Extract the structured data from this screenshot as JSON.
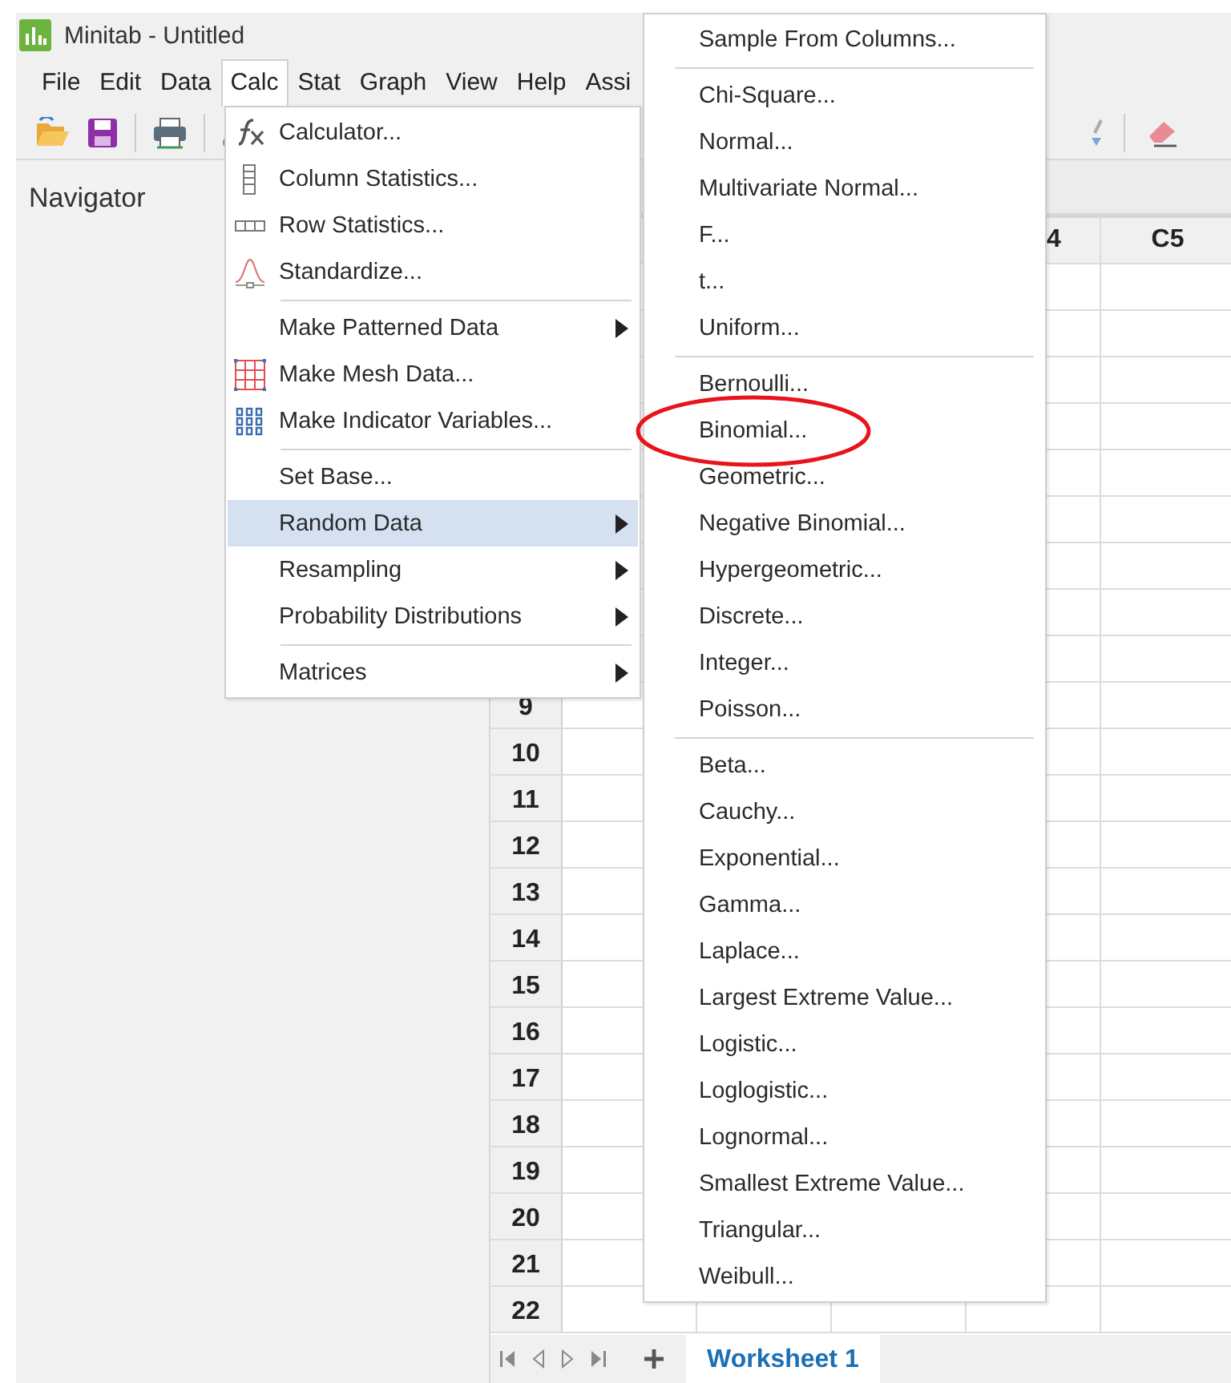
{
  "window": {
    "title": "Minitab - Untitled"
  },
  "menu_bar": [
    {
      "label": "File",
      "selected": false
    },
    {
      "label": "Edit",
      "selected": false
    },
    {
      "label": "Data",
      "selected": false
    },
    {
      "label": "Calc",
      "selected": true
    },
    {
      "label": "Stat",
      "selected": false
    },
    {
      "label": "Graph",
      "selected": false
    },
    {
      "label": "View",
      "selected": false
    },
    {
      "label": "Help",
      "selected": false
    },
    {
      "label": "Assi",
      "selected": false
    }
  ],
  "navigator": {
    "title": "Navigator"
  },
  "calc_menu": {
    "items": [
      {
        "kind": "item",
        "label": "Calculator...",
        "submenu": false,
        "selected": false
      },
      {
        "kind": "item",
        "label": "Column Statistics...",
        "submenu": false,
        "selected": false
      },
      {
        "kind": "item",
        "label": "Row Statistics...",
        "submenu": false,
        "selected": false
      },
      {
        "kind": "item",
        "label": "Standardize...",
        "submenu": false,
        "selected": false
      },
      {
        "kind": "separator"
      },
      {
        "kind": "item",
        "label": "Make Patterned Data",
        "submenu": true,
        "selected": false
      },
      {
        "kind": "item",
        "label": "Make Mesh Data...",
        "submenu": false,
        "selected": false
      },
      {
        "kind": "item",
        "label": "Make Indicator Variables...",
        "submenu": false,
        "selected": false
      },
      {
        "kind": "separator"
      },
      {
        "kind": "item",
        "label": "Set Base...",
        "submenu": false,
        "selected": false
      },
      {
        "kind": "item",
        "label": "Random Data",
        "submenu": true,
        "selected": true
      },
      {
        "kind": "item",
        "label": "Resampling",
        "submenu": true,
        "selected": false
      },
      {
        "kind": "item",
        "label": "Probability Distributions",
        "submenu": true,
        "selected": false
      },
      {
        "kind": "separator"
      },
      {
        "kind": "item",
        "label": "Matrices",
        "submenu": true,
        "selected": false
      }
    ]
  },
  "random_data_menu": {
    "items": [
      {
        "kind": "item",
        "label": "Sample From Columns...",
        "circled": false
      },
      {
        "kind": "separator"
      },
      {
        "kind": "item",
        "label": "Chi-Square...",
        "circled": false
      },
      {
        "kind": "item",
        "label": "Normal...",
        "circled": false
      },
      {
        "kind": "item",
        "label": "Multivariate Normal...",
        "circled": false
      },
      {
        "kind": "item",
        "label": "F...",
        "circled": false
      },
      {
        "kind": "item",
        "label": "t...",
        "circled": false
      },
      {
        "kind": "item",
        "label": "Uniform...",
        "circled": false
      },
      {
        "kind": "separator"
      },
      {
        "kind": "item",
        "label": "Bernoulli...",
        "circled": false
      },
      {
        "kind": "item",
        "label": "Binomial...",
        "circled": true
      },
      {
        "kind": "item",
        "label": "Geometric...",
        "circled": false
      },
      {
        "kind": "item",
        "label": "Negative Binomial...",
        "circled": false
      },
      {
        "kind": "item",
        "label": "Hypergeometric...",
        "circled": false
      },
      {
        "kind": "item",
        "label": "Discrete...",
        "circled": false
      },
      {
        "kind": "item",
        "label": "Integer...",
        "circled": false
      },
      {
        "kind": "item",
        "label": "Poisson...",
        "circled": false
      },
      {
        "kind": "separator"
      },
      {
        "kind": "item",
        "label": "Beta...",
        "circled": false
      },
      {
        "kind": "item",
        "label": "Cauchy...",
        "circled": false
      },
      {
        "kind": "item",
        "label": "Exponential...",
        "circled": false
      },
      {
        "kind": "item",
        "label": "Gamma...",
        "circled": false
      },
      {
        "kind": "item",
        "label": "Laplace...",
        "circled": false
      },
      {
        "kind": "item",
        "label": "Largest Extreme Value...",
        "circled": false
      },
      {
        "kind": "item",
        "label": "Logistic...",
        "circled": false
      },
      {
        "kind": "item",
        "label": "Loglogistic...",
        "circled": false
      },
      {
        "kind": "item",
        "label": "Lognormal...",
        "circled": false
      },
      {
        "kind": "item",
        "label": "Smallest Extreme Value...",
        "circled": false
      },
      {
        "kind": "item",
        "label": "Triangular...",
        "circled": false
      },
      {
        "kind": "item",
        "label": "Weibull...",
        "circled": false
      }
    ]
  },
  "worksheet": {
    "columns": [
      {
        "header": "4"
      },
      {
        "header": "C5"
      }
    ],
    "rows": [
      "9",
      "10",
      "11",
      "12",
      "13",
      "14",
      "15",
      "16",
      "17",
      "18",
      "19",
      "20",
      "21",
      "22"
    ]
  },
  "sheet_tabs": [
    {
      "label": "Worksheet 1",
      "selected": true
    }
  ]
}
